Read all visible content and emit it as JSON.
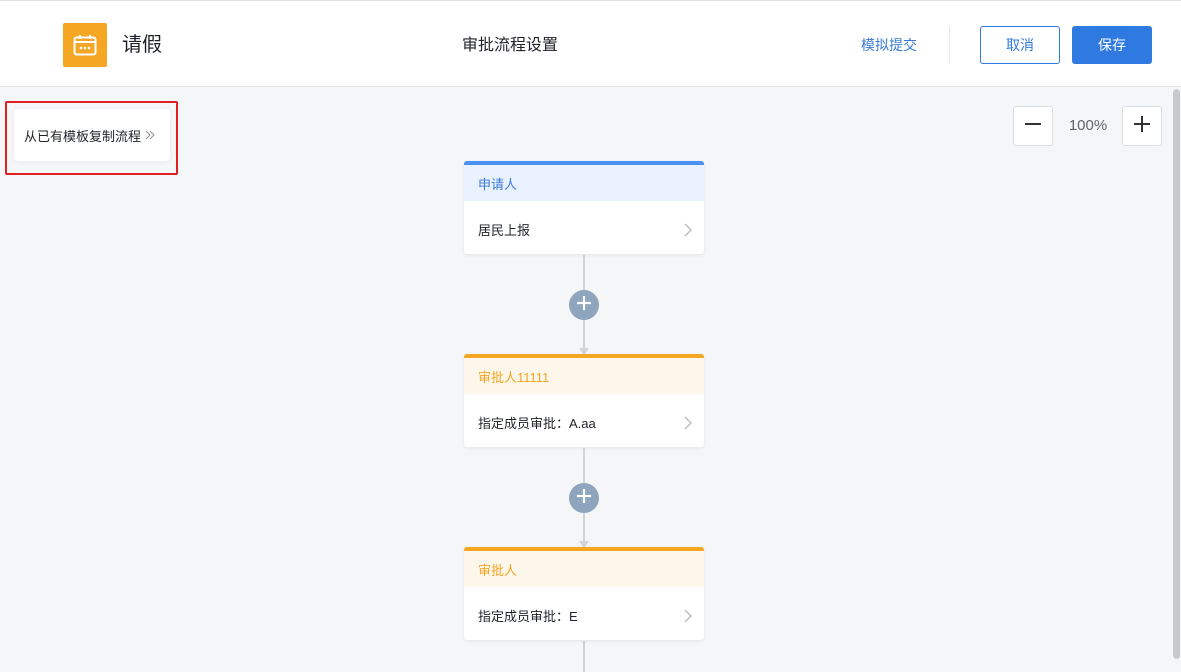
{
  "header": {
    "app_name": "请假",
    "page_title": "审批流程设置",
    "simulate_label": "模拟提交",
    "cancel_label": "取消",
    "save_label": "保存",
    "app_icon": "calendar-icon",
    "accent_color": "#2e7ae0",
    "app_icon_color": "#f5a623"
  },
  "toolbar": {
    "copy_template_label": "从已有模板复制流程",
    "copy_template_icon": "double-chevron-right-icon",
    "zoom_level": "100%",
    "zoom_out_icon": "minus-icon",
    "zoom_in_icon": "plus-icon"
  },
  "flow": {
    "nodes": [
      {
        "title": "申请人",
        "content": "居民上报",
        "kind": "applicant",
        "color": "#4a90f0"
      },
      {
        "title": "审批人11111",
        "content": "指定成员审批：A.aa",
        "kind": "approver",
        "color": "#f5a623"
      },
      {
        "title": "审批人",
        "content": "指定成员审批：E",
        "kind": "approver",
        "color": "#f5a623"
      }
    ],
    "add_node_icon": "plus-circle-icon",
    "add_button_color": "#8fa5bd"
  }
}
